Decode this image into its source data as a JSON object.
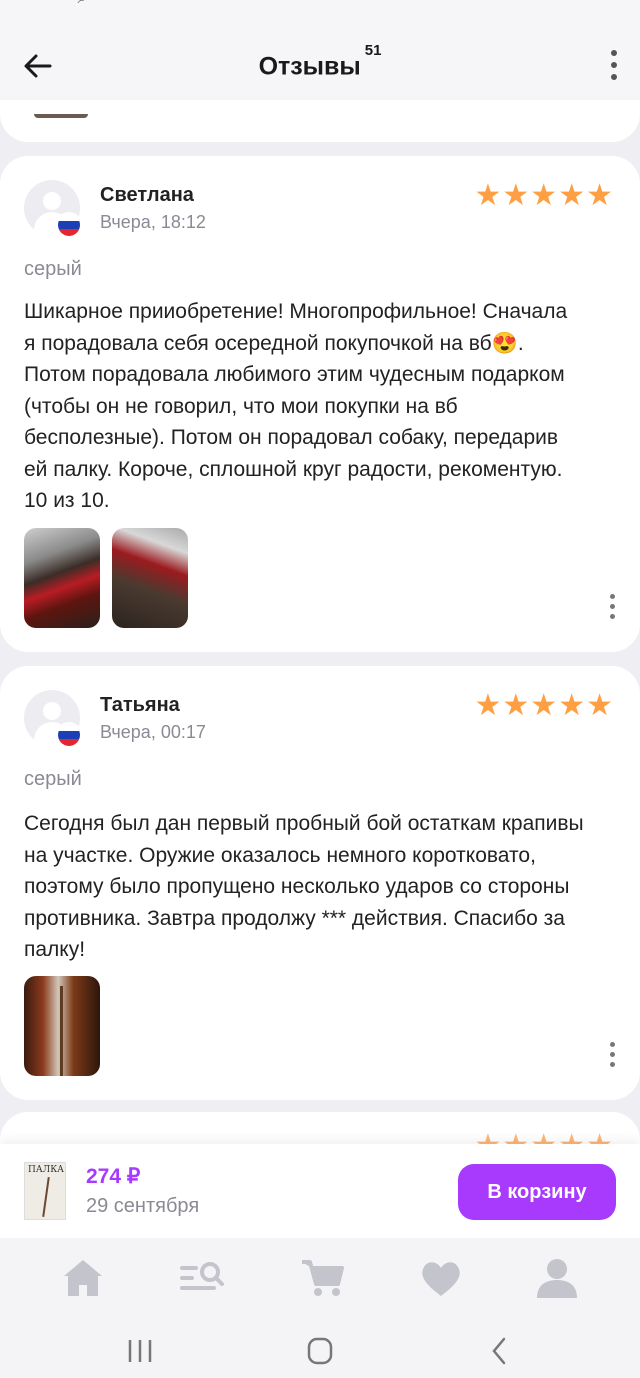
{
  "header": {
    "title": "Отзывы",
    "count": "51"
  },
  "reviews": [
    {
      "name": "Светлана",
      "date": "Вчера, 18:12",
      "rating": 5,
      "stars": "★★★★★",
      "variant": "серый",
      "text": "Шикарное прииобретение! Многопрофильное! Сначала я порадовала себя осередной покупочкой на вб😍. Потом порадовала любимого этим чудесным подарком (чтобы он не говорил, что мои покупки на вб бесполезные). Потом он порадовал собаку, передарив ей палку. Короче, сплошной круг радости, рекоментую. 10 из 10."
    },
    {
      "name": "Татьяна",
      "date": "Вчера, 00:17",
      "rating": 5,
      "stars": "★★★★★",
      "variant": "серый",
      "text": "Сегодня был дан первый пробный бой остаткам крапивы на участке. Оружие оказалось немного коротковато, поэтому было пропущено несколько ударов со стороны противника. Завтра продолжу *** действия. Спасибо за палку!"
    }
  ],
  "next_review": {
    "stars": "★★★★★"
  },
  "buybar": {
    "product_label": "ПАЛКА",
    "price": "274 ₽",
    "delivery": "29 сентября",
    "cart_button": "В корзину"
  },
  "tabs": [
    {
      "icon": "home-icon"
    },
    {
      "icon": "catalog-search-icon"
    },
    {
      "icon": "cart-icon"
    },
    {
      "icon": "heart-icon"
    },
    {
      "icon": "profile-icon"
    }
  ],
  "navbar": [
    {
      "icon": "recent-apps-icon"
    },
    {
      "icon": "home-circle-icon"
    },
    {
      "icon": "back-chevron-icon"
    }
  ],
  "colors": {
    "accent": "#a73afd",
    "star": "#ff9f43",
    "muted": "#8a8a95",
    "background": "#eeeef3"
  }
}
